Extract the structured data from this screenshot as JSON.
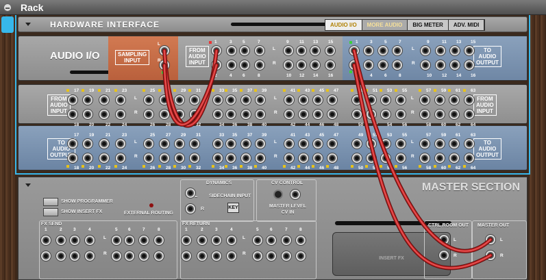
{
  "window": {
    "title": "Rack"
  },
  "hardware_interface": {
    "name": "HARDWARE INTERFACE",
    "tabs": [
      {
        "label": "AUDIO I/O",
        "state": "active"
      },
      {
        "label": "MORE AUDIO",
        "state": "highlight"
      },
      {
        "label": "BIG METER",
        "state": "normal"
      },
      {
        "label": "ADV. MIDI",
        "state": "normal"
      }
    ]
  },
  "audio_io": {
    "label": "AUDIO I/O",
    "sampling_input": "SAMPLING\nINPUT",
    "from_audio_input": "FROM\nAUDIO\nINPUT",
    "to_audio_output": "TO\nAUDIO\nOUTPUT",
    "ch_from": {
      "top": [
        "1",
        "3",
        "5",
        "7",
        "9",
        "11",
        "13",
        "15"
      ],
      "bottom": [
        "2",
        "4",
        "6",
        "8",
        "10",
        "12",
        "14",
        "16"
      ]
    },
    "ch_to": {
      "top": [
        "1",
        "3",
        "5",
        "7",
        "9",
        "11",
        "13",
        "15"
      ],
      "bottom": [
        "2",
        "4",
        "6",
        "8",
        "10",
        "12",
        "14",
        "16"
      ]
    },
    "l": "L",
    "r": "R"
  },
  "more_audio_in": {
    "from": "FROM\nAUDIO\nINPUT",
    "top": [
      "17",
      "19",
      "21",
      "23",
      "25",
      "27",
      "29",
      "31",
      "33",
      "35",
      "37",
      "39",
      "41",
      "43",
      "45",
      "47",
      "49",
      "51",
      "53",
      "55",
      "57",
      "59",
      "61",
      "63"
    ],
    "bottom": [
      "18",
      "20",
      "22",
      "24",
      "26",
      "28",
      "30",
      "32",
      "34",
      "36",
      "38",
      "40",
      "42",
      "44",
      "46",
      "48",
      "50",
      "52",
      "54",
      "56",
      "58",
      "60",
      "62",
      "64"
    ]
  },
  "more_audio_out": {
    "to": "TO\nAUDIO\nOUTPUT",
    "top": [
      "17",
      "19",
      "21",
      "23",
      "25",
      "27",
      "29",
      "31",
      "33",
      "35",
      "37",
      "39",
      "41",
      "43",
      "45",
      "47",
      "49",
      "51",
      "53",
      "55",
      "57",
      "59",
      "61",
      "63"
    ],
    "bottom": [
      "18",
      "20",
      "22",
      "24",
      "26",
      "28",
      "30",
      "32",
      "34",
      "36",
      "38",
      "40",
      "42",
      "44",
      "46",
      "48",
      "50",
      "52",
      "54",
      "56",
      "58",
      "60",
      "62",
      "64"
    ]
  },
  "master_section": {
    "title": "MASTER SECTION",
    "show_programmer": "SHOW PROGRAMMER",
    "show_insert_fx": "SHOW INSERT FX",
    "external_routing": "EXTERNAL ROUTING",
    "dynamics": "DYNAMICS",
    "sidechain_input": "SIDECHAIN INPUT",
    "key": "KEY",
    "cv_control": "CV CONTROL",
    "master_level_cv_in": "MASTER LEVEL\nCV IN",
    "fx_send": "FX SEND",
    "fx_return": "FX RETURN",
    "fx_numbers": [
      "1",
      "2",
      "3",
      "4",
      "5",
      "6",
      "7",
      "8"
    ],
    "ctrl_room_out": "CTRL ROOM OUT",
    "master_out": "MASTER  OUT",
    "insert_fx": "INSERT FX",
    "l": "L",
    "r": "R"
  }
}
